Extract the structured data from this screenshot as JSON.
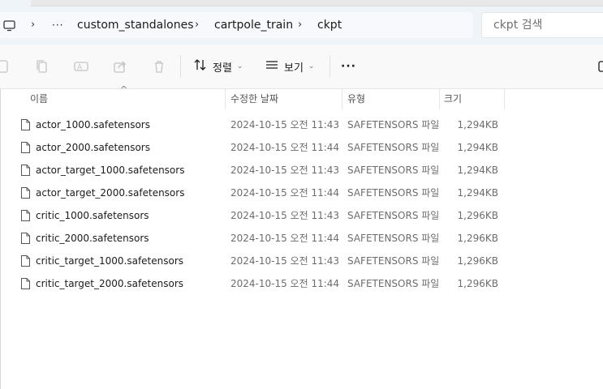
{
  "breadcrumb": {
    "overflow": "···",
    "items": [
      "custom_standalones",
      "cartpole_train",
      "ckpt"
    ]
  },
  "search": {
    "placeholder": "ckpt 검색"
  },
  "toolbar": {
    "sort_label": "정렬",
    "view_label": "보기",
    "more_label": "···"
  },
  "columns": {
    "name": "이름",
    "date": "수정한 날짜",
    "type": "유형",
    "size": "크기"
  },
  "files": [
    {
      "name": "actor_1000.safetensors",
      "date": "2024-10-15 오전 11:43",
      "type": "SAFETENSORS 파일",
      "size": "1,294KB"
    },
    {
      "name": "actor_2000.safetensors",
      "date": "2024-10-15 오전 11:44",
      "type": "SAFETENSORS 파일",
      "size": "1,294KB"
    },
    {
      "name": "actor_target_1000.safetensors",
      "date": "2024-10-15 오전 11:43",
      "type": "SAFETENSORS 파일",
      "size": "1,294KB"
    },
    {
      "name": "actor_target_2000.safetensors",
      "date": "2024-10-15 오전 11:44",
      "type": "SAFETENSORS 파일",
      "size": "1,294KB"
    },
    {
      "name": "critic_1000.safetensors",
      "date": "2024-10-15 오전 11:43",
      "type": "SAFETENSORS 파일",
      "size": "1,296KB"
    },
    {
      "name": "critic_2000.safetensors",
      "date": "2024-10-15 오전 11:44",
      "type": "SAFETENSORS 파일",
      "size": "1,296KB"
    },
    {
      "name": "critic_target_1000.safetensors",
      "date": "2024-10-15 오전 11:43",
      "type": "SAFETENSORS 파일",
      "size": "1,296KB"
    },
    {
      "name": "critic_target_2000.safetensors",
      "date": "2024-10-15 오전 11:44",
      "type": "SAFETENSORS 파일",
      "size": "1,296KB"
    }
  ]
}
